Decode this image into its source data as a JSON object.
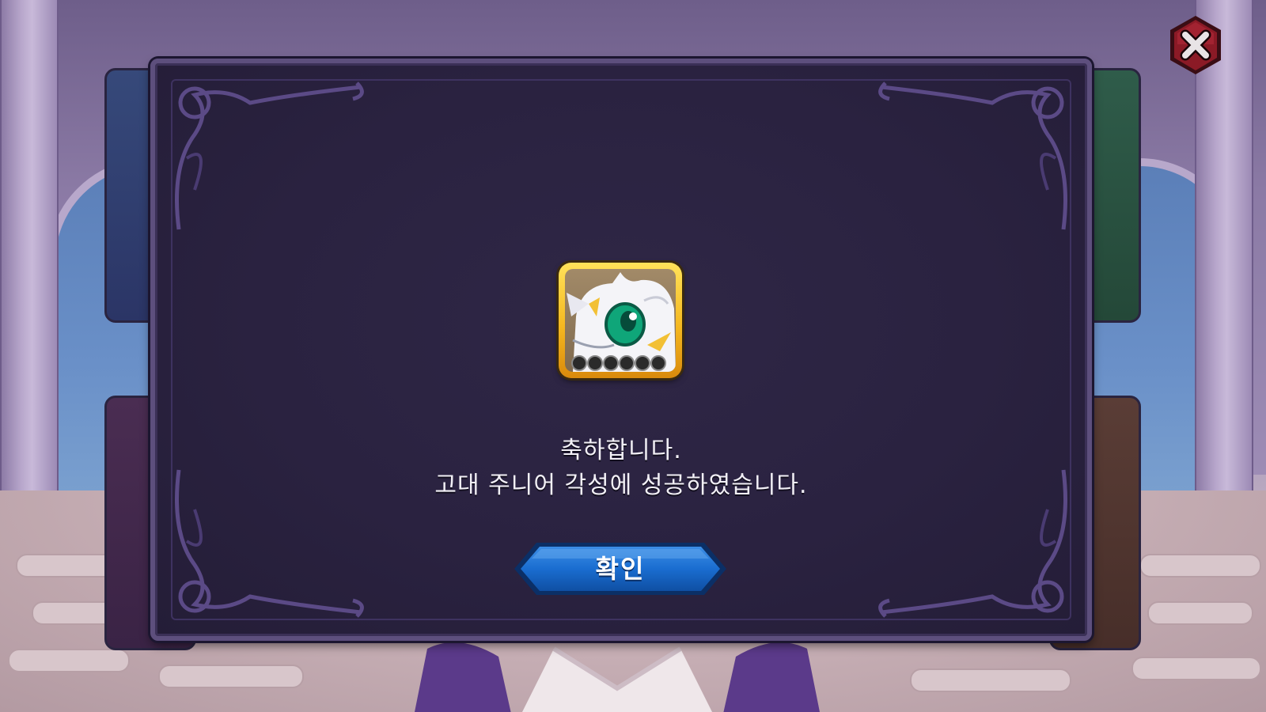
{
  "dialog": {
    "message_line1": "축하합니다.",
    "message_line2": "고대 주니어 각성에 성공하였습니다.",
    "confirm_label": "확인"
  },
  "reward": {
    "icon": "white-dragon-pet-icon",
    "star_slots": 6,
    "stars_filled": 0
  },
  "icons": {
    "close": "close-icon",
    "confirm": "confirm-button"
  },
  "colors": {
    "dialog_bg": "#2a2240",
    "dialog_border": "#5d4f7d",
    "button_blue": "#1565c0",
    "frame_gold": "#f5b820",
    "close_red": "#8b1a26",
    "text": "#f2f0f6"
  }
}
